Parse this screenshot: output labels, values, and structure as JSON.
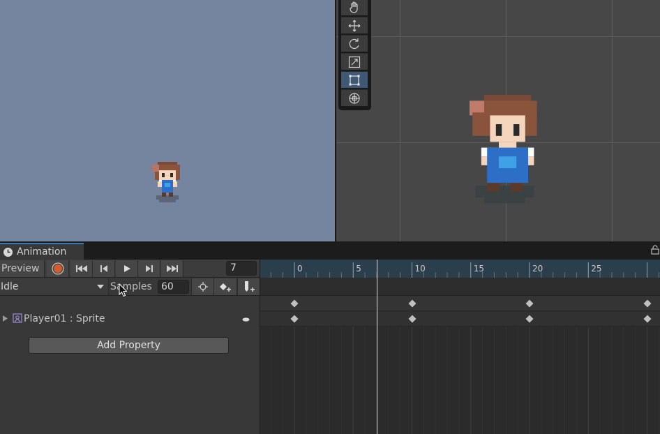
{
  "panel_tab": {
    "label": "Animation",
    "icon": "clock-icon",
    "lock_icon": "lock-icon"
  },
  "toolbar": {
    "preview_label": "Preview",
    "record_icon": "record-icon",
    "first_keyframe_icon": "first-keyframe-icon",
    "prev_keyframe_icon": "previous-keyframe-icon",
    "play_icon": "play-icon",
    "next_keyframe_icon": "next-keyframe-icon",
    "last_keyframe_icon": "last-keyframe-icon",
    "current_frame": "7"
  },
  "clip_row": {
    "clip_name": "Idle",
    "samples_label": "Samples",
    "samples_value": "60",
    "buttons": [
      "filter-by-selection-icon",
      "add-keyframe-icon",
      "add-event-icon"
    ]
  },
  "property": {
    "label": "Player01 : Sprite",
    "icon": "sprite-renderer-icon",
    "expand_icon": "expand-arrow-icon"
  },
  "add_property_label": "Add Property",
  "timeline": {
    "ruler_labels": [
      "0",
      "5",
      "10",
      "15",
      "20",
      "25"
    ],
    "keyframes": [
      0,
      10,
      20,
      30
    ],
    "playhead_frame": 7
  },
  "scene_tools": [
    "hand-tool-icon",
    "move-tool-icon",
    "rotate-tool-icon",
    "scale-tool-icon",
    "rect-tool-icon",
    "transform-tool-icon"
  ],
  "active_scene_tool": "rect-tool-icon",
  "colors": {
    "game_background": "#7585a0",
    "scene_background": "#474747",
    "ruler_background": "#2a3e4b",
    "record_red": "#d65a2a",
    "accent_blue": "#3a79bb"
  }
}
